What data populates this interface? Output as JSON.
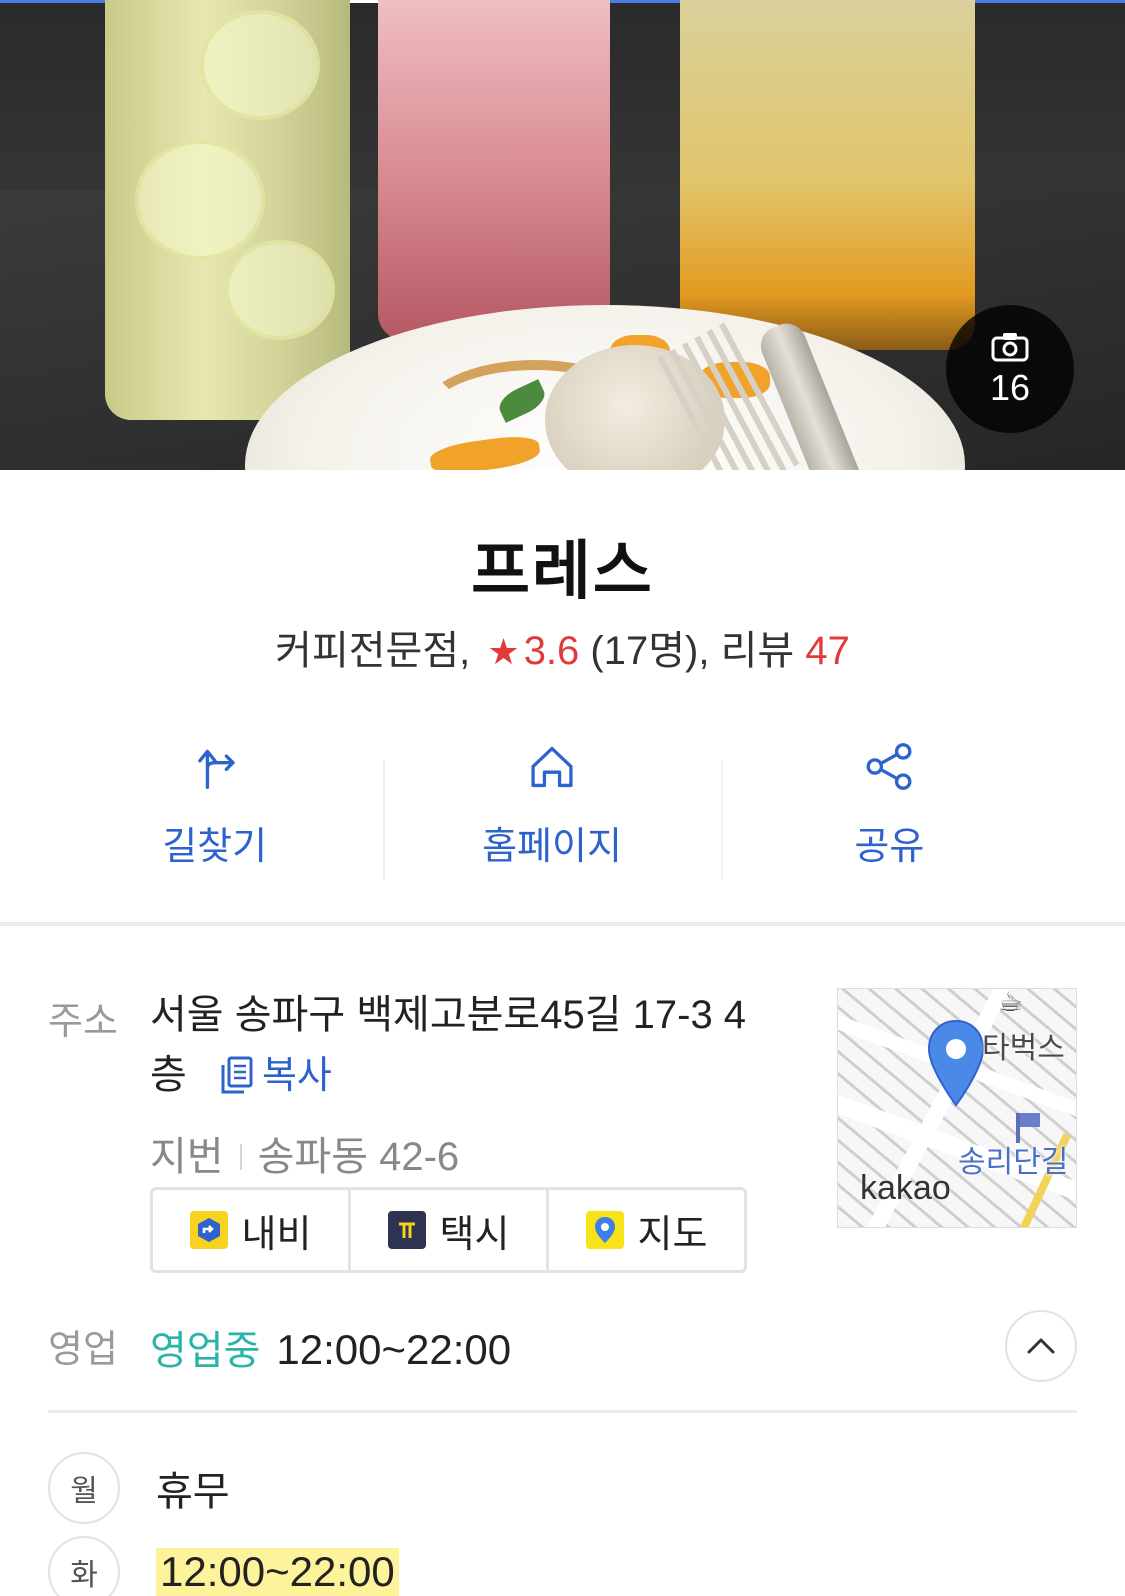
{
  "hero": {
    "photo_count": "16",
    "camera_icon": "camera-icon"
  },
  "place": {
    "name": "프레스",
    "category": "커피전문점,",
    "rating": "3.6",
    "rating_count": "(17명),",
    "review_label": "리뷰",
    "review_count": "47",
    "star_icon": "star-icon"
  },
  "actions": [
    {
      "label": "길찾기",
      "icon": "directions-icon"
    },
    {
      "label": "홈페이지",
      "icon": "home-icon"
    },
    {
      "label": "공유",
      "icon": "share-icon"
    }
  ],
  "address": {
    "label": "주소",
    "line1": "서울 송파구 백제고분로45길 17-3 4",
    "line2": "층",
    "copy_label": "복사",
    "jibun_label": "지번",
    "jibun_value": "송파동 42-6",
    "quick_links": [
      {
        "label": "내비",
        "icon": "navi-icon",
        "color": "#f7d21e"
      },
      {
        "label": "택시",
        "icon": "taxi-icon",
        "color": "#2d3350"
      },
      {
        "label": "지도",
        "icon": "map-pin-icon",
        "color": "#f7e318"
      }
    ]
  },
  "map": {
    "poi_1": "타벅스",
    "poi_2": "송리단길",
    "brand": "kakao"
  },
  "hours": {
    "label": "영업",
    "status": "영업중",
    "time": "12:00~22:00",
    "days": [
      {
        "day": "월",
        "value": "휴무"
      },
      {
        "day": "화",
        "value": "12:00~22:00"
      }
    ]
  },
  "colors": {
    "accent_blue": "#2e62cc",
    "rating_red": "#e03a3a",
    "open_teal": "#2ab3a8",
    "highlight_yellow": "#fdf39a"
  }
}
